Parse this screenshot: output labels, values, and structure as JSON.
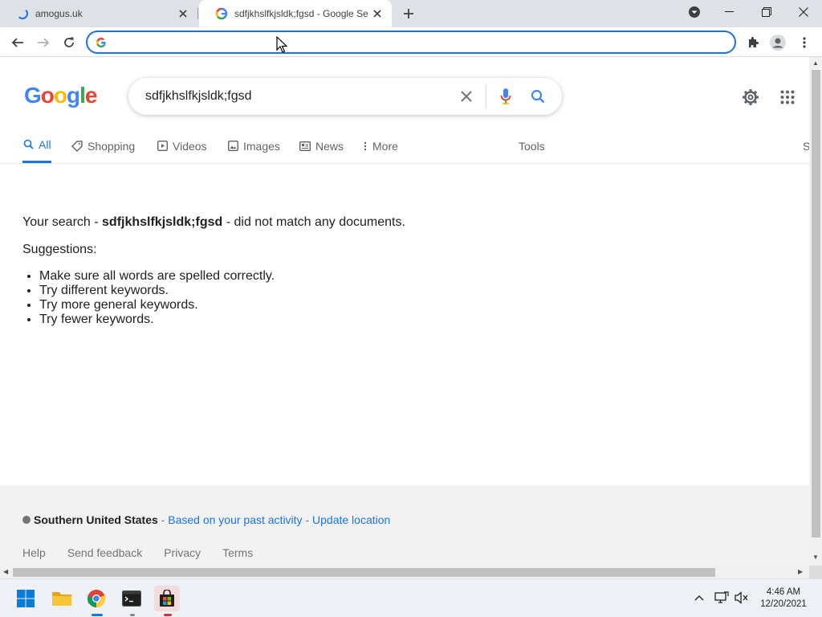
{
  "tabs": [
    {
      "title": "amogus.uk",
      "state": "loading"
    },
    {
      "title": "sdfjkhslfkjsldk;fgsd - Google Sear",
      "state": "active"
    }
  ],
  "omnibox": {
    "value": ""
  },
  "google": {
    "logo_letters": [
      "G",
      "o",
      "o",
      "g",
      "l",
      "e"
    ],
    "logo_colors": [
      "#4285f4",
      "#ea4335",
      "#fbbc05",
      "#4285f4",
      "#34a853",
      "#ea4335"
    ],
    "query": "sdfjkhslfkjsldk;fgsd"
  },
  "nav": {
    "all": "All",
    "shopping": "Shopping",
    "videos": "Videos",
    "images": "Images",
    "news": "News",
    "more": "More",
    "tools": "Tools",
    "cut": "S"
  },
  "results": {
    "prefix": "Your search - ",
    "query": "sdfjkhslfkjsldk;fgsd",
    "suffix": " - did not match any documents.",
    "suggestions_label": "Suggestions:",
    "suggestions": [
      "Make sure all words are spelled correctly.",
      "Try different keywords.",
      "Try more general keywords.",
      "Try fewer keywords."
    ]
  },
  "footer": {
    "location": "Southern United States",
    "sep1": " - ",
    "activity": "Based on your past activity",
    "sep2": " - ",
    "update": "Update location",
    "links": [
      "Help",
      "Send feedback",
      "Privacy",
      "Terms"
    ]
  },
  "clock": {
    "time": "4:46 AM",
    "date": "12/20/2021"
  },
  "colors": {
    "accent": "#1a73e8",
    "tabstrip": "#dee1e6"
  }
}
